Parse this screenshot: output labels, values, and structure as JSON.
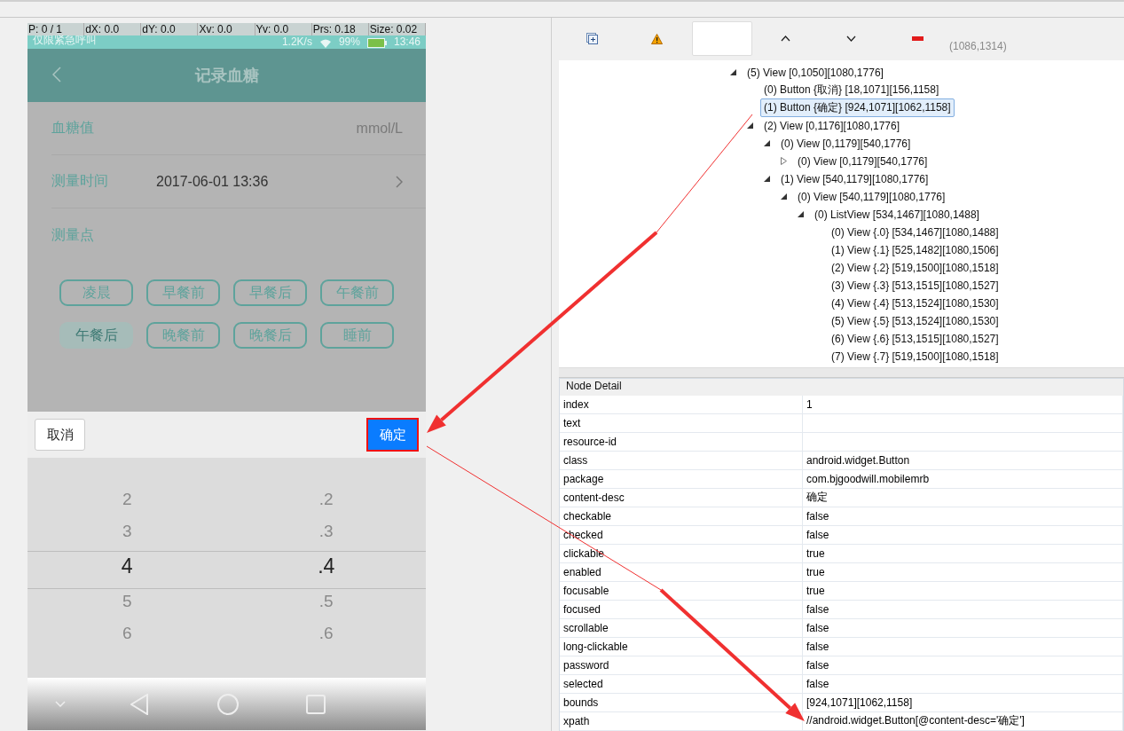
{
  "phone": {
    "debug_overlay": [
      "P: 0 / 1",
      "dX: 0.0",
      "dY: 0.0",
      "Xv: 0.0",
      "Yv: 0.0",
      "Prs: 0.18",
      "Size: 0.02"
    ],
    "status_bar": {
      "carrier": "仅限紧急呼叫",
      "speed": "1.2K/s",
      "battery": "99%",
      "time": "13:46"
    },
    "header": {
      "title": "记录血糖"
    },
    "form": [
      {
        "kind": "unit",
        "label": "血糖值",
        "value": "mmol/L"
      },
      {
        "kind": "link",
        "label": "测量时间",
        "value": "2017-06-01 13:36"
      },
      {
        "kind": "heading",
        "label": "测量点"
      }
    ],
    "chips": [
      {
        "label": "凌晨",
        "selected": false
      },
      {
        "label": "早餐前",
        "selected": false
      },
      {
        "label": "早餐后",
        "selected": false
      },
      {
        "label": "午餐前",
        "selected": false
      },
      {
        "label": "午餐后",
        "selected": true
      },
      {
        "label": "晚餐前",
        "selected": false
      },
      {
        "label": "晚餐后",
        "selected": false
      },
      {
        "label": "睡前",
        "selected": false
      }
    ],
    "picker_bar": {
      "cancel": "取消",
      "confirm": "确定"
    },
    "picker_columns": [
      {
        "items": [
          {
            "label": "2",
            "selected": false
          },
          {
            "label": "3",
            "selected": false
          },
          {
            "label": "4",
            "selected": true
          },
          {
            "label": "5",
            "selected": false
          },
          {
            "label": "6",
            "selected": false
          }
        ]
      },
      {
        "items": [
          {
            "label": ".2",
            "selected": false
          },
          {
            "label": ".3",
            "selected": false
          },
          {
            "label": ".4",
            "selected": true
          },
          {
            "label": ".5",
            "selected": false
          },
          {
            "label": ".6",
            "selected": false
          }
        ]
      }
    ]
  },
  "toolbar": {
    "coordinates": "(1086,1314)"
  },
  "tree": [
    {
      "label": "(5) View [0,1050][1080,1776]",
      "selected": false,
      "expanded": true,
      "children": [
        {
          "label": "(0) Button {取消} [18,1071][156,1158]",
          "selected": false
        },
        {
          "label": "(1) Button {确定} [924,1071][1062,1158]",
          "selected": true
        },
        {
          "label": "(2) View [0,1176][1080,1776]",
          "selected": false,
          "expanded": true,
          "children": [
            {
              "label": "(0) View [0,1179][540,1776]",
              "selected": false,
              "expanded": true,
              "children": [
                {
                  "label": "(0) View [0,1179][540,1776]",
                  "selected": false,
                  "expanded": false
                }
              ]
            },
            {
              "label": "(1) View [540,1179][1080,1776]",
              "selected": false,
              "expanded": true,
              "children": [
                {
                  "label": "(0) View [540,1179][1080,1776]",
                  "selected": false,
                  "expanded": true,
                  "children": [
                    {
                      "label": "(0) ListView [534,1467][1080,1488]",
                      "selected": false,
                      "expanded": true,
                      "children": [
                        {
                          "label": "(0) View {.0} [534,1467][1080,1488]",
                          "selected": false
                        },
                        {
                          "label": "(1) View {.1} [525,1482][1080,1506]",
                          "selected": false
                        },
                        {
                          "label": "(2) View {.2} [519,1500][1080,1518]",
                          "selected": false
                        },
                        {
                          "label": "(3) View {.3} [513,1515][1080,1527]",
                          "selected": false
                        },
                        {
                          "label": "(4) View {.4} [513,1524][1080,1530]",
                          "selected": false
                        },
                        {
                          "label": "(5) View {.5} [513,1524][1080,1530]",
                          "selected": false
                        },
                        {
                          "label": "(6) View {.6} [513,1515][1080,1527]",
                          "selected": false
                        },
                        {
                          "label": "(7) View {.7} [519,1500][1080,1518]",
                          "selected": false
                        }
                      ]
                    }
                  ]
                }
              ]
            }
          ]
        }
      ]
    }
  ],
  "node_detail": {
    "title": "Node Detail",
    "rows": [
      {
        "key": "index",
        "value": "1"
      },
      {
        "key": "text"
      },
      {
        "key": "resource-id"
      },
      {
        "key": "class",
        "value": "android.widget.Button"
      },
      {
        "key": "package",
        "value": "com.bjgoodwill.mobilemrb"
      },
      {
        "key": "content-desc",
        "value": "确定"
      },
      {
        "key": "checkable",
        "value": "false"
      },
      {
        "key": "checked",
        "value": "false"
      },
      {
        "key": "clickable",
        "value": "true"
      },
      {
        "key": "enabled",
        "value": "true"
      },
      {
        "key": "focusable",
        "value": "true"
      },
      {
        "key": "focused",
        "value": "false"
      },
      {
        "key": "scrollable",
        "value": "false"
      },
      {
        "key": "long-clickable",
        "value": "false"
      },
      {
        "key": "password",
        "value": "false"
      },
      {
        "key": "selected",
        "value": "false"
      },
      {
        "key": "bounds",
        "value": "[924,1071][1062,1158]"
      },
      {
        "key": "xpath",
        "value": "//android.widget.Button[@content-desc='确定']"
      }
    ]
  }
}
